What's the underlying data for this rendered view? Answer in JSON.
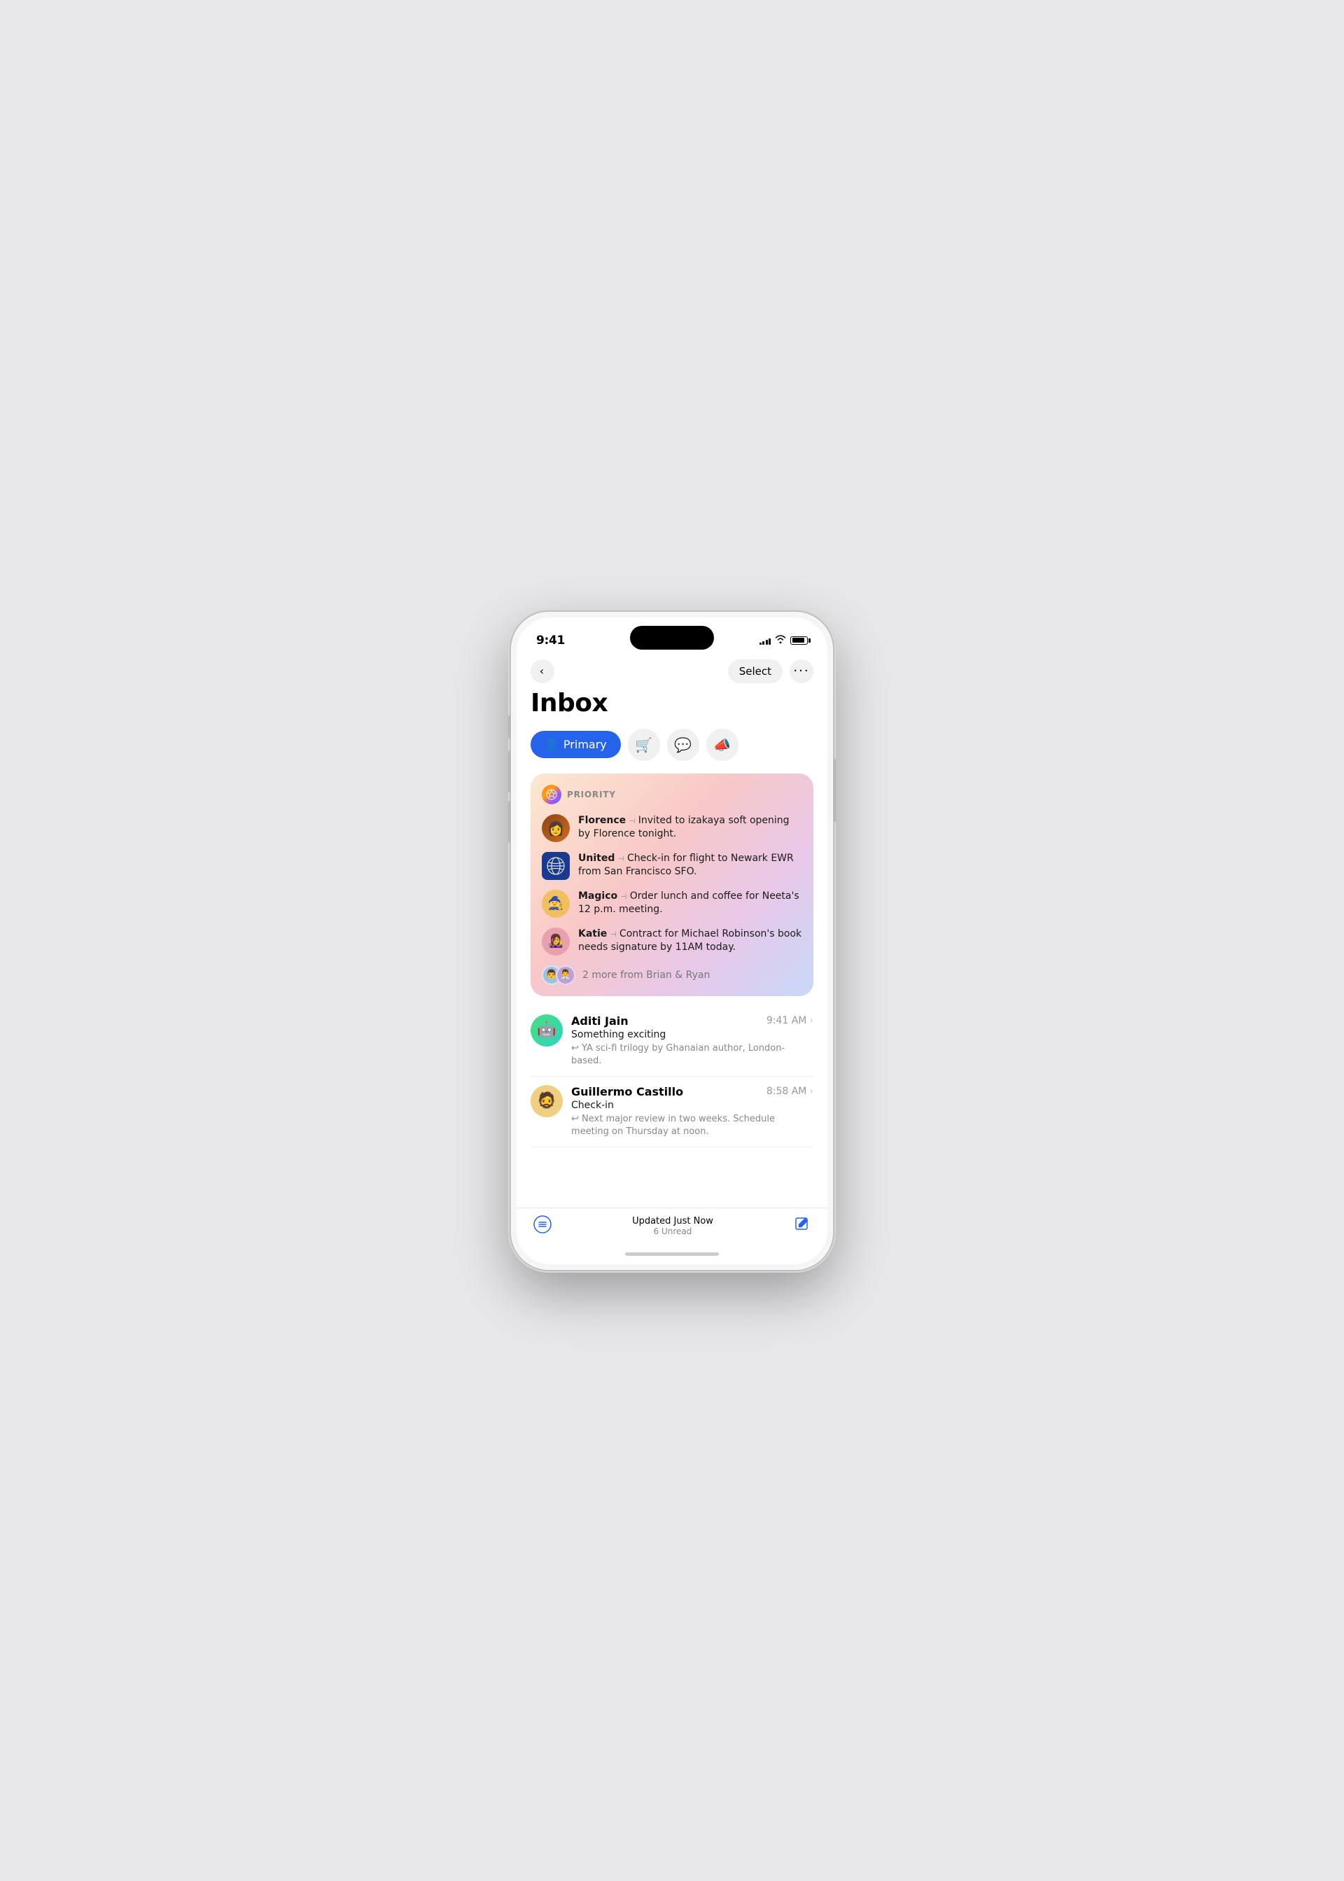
{
  "status_bar": {
    "time": "9:41",
    "signal_bars": [
      3,
      5,
      7,
      9,
      11
    ],
    "battery_level": 85
  },
  "nav": {
    "back_label": "‹",
    "select_label": "Select",
    "more_label": "•••"
  },
  "page_title": "Inbox",
  "filter_tabs": [
    {
      "id": "primary",
      "label": "Primary",
      "icon": "👤",
      "active": true
    },
    {
      "id": "shopping",
      "label": "",
      "icon": "🛒",
      "active": false
    },
    {
      "id": "messages",
      "label": "",
      "icon": "💬",
      "active": false
    },
    {
      "id": "promotions",
      "label": "",
      "icon": "📣",
      "active": false
    }
  ],
  "priority_section": {
    "label": "PRIORITY",
    "items": [
      {
        "sender": "Florence",
        "preview": "Invited to izakaya soft opening by Florence tonight.",
        "avatar_emoji": "👩",
        "avatar_bg": "#c8804a"
      },
      {
        "sender": "United",
        "preview": "Check-in for flight to Newark EWR from San Francisco SFO.",
        "avatar_emoji": "🌐",
        "is_united": true
      },
      {
        "sender": "Magico",
        "preview": "Order lunch and coffee for Neeta's 12 p.m. meeting.",
        "avatar_emoji": "🧙",
        "avatar_bg": "#e0b840"
      },
      {
        "sender": "Katie",
        "preview": "Contract for Michael Robinson's book needs signature by 11AM today.",
        "avatar_emoji": "👩‍🎤",
        "avatar_bg": "#e8a0b0"
      }
    ],
    "more_text": "2 more from Brian & Ryan"
  },
  "email_list": [
    {
      "sender": "Aditi Jain",
      "time": "9:41 AM",
      "subject": "Something exciting",
      "preview": "↩ YA sci-fi trilogy by Ghanaian author, London-based.",
      "avatar_emoji": "🤖",
      "avatar_bg": "linear-gradient(135deg, #4ade80, #2dd4bf)"
    },
    {
      "sender": "Guillermo Castillo",
      "time": "8:58 AM",
      "subject": "Check-in",
      "preview": "↩ Next major review in two weeks. Schedule meeting on Thursday at noon.",
      "avatar_emoji": "🧔",
      "avatar_bg": "#f0d080"
    }
  ],
  "bottom_bar": {
    "updated_text": "Updated Just Now",
    "unread_text": "6 Unread"
  }
}
